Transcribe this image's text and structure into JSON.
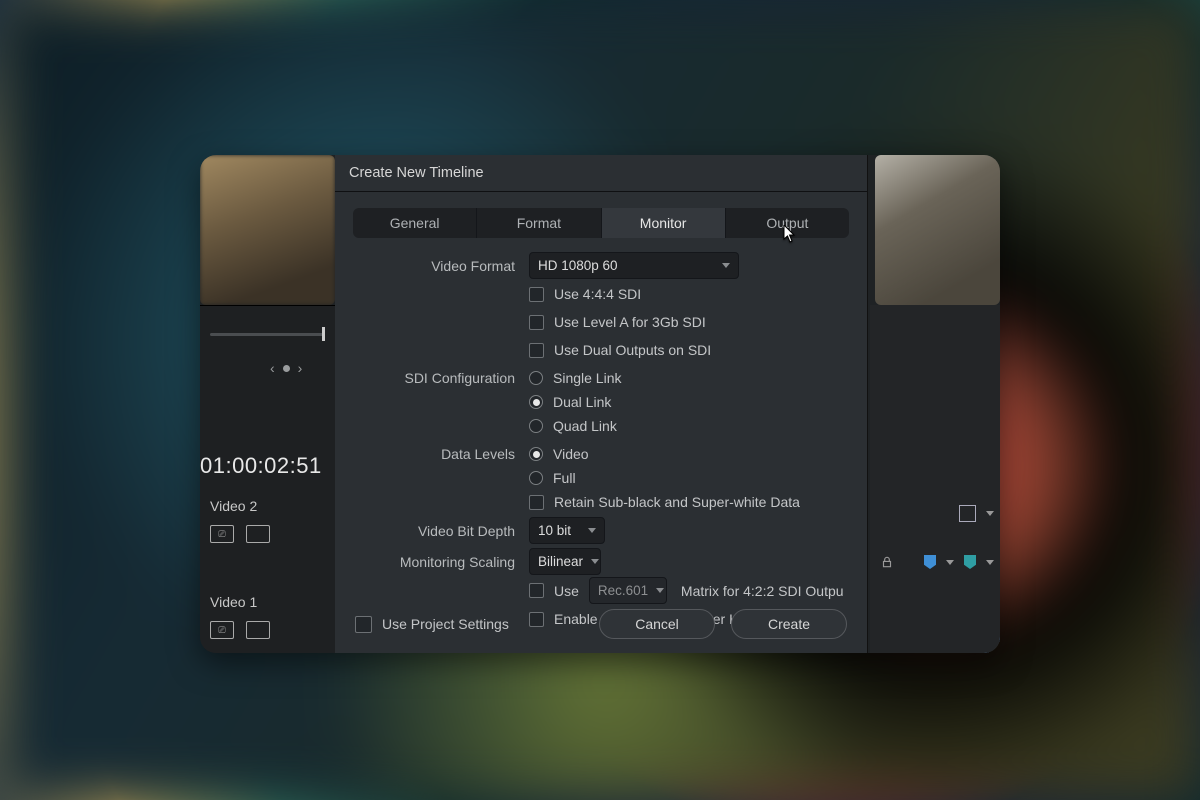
{
  "dialog": {
    "title": "Create New Timeline",
    "tabs": {
      "general": "General",
      "format": "Format",
      "monitor": "Monitor",
      "output": "Output"
    },
    "active_tab": "monitor",
    "labels": {
      "video_format": "Video Format",
      "sdi_config": "SDI Configuration",
      "data_levels": "Data Levels",
      "bit_depth": "Video Bit Depth",
      "scaling": "Monitoring Scaling"
    },
    "video_format_value": "HD 1080p 60",
    "use_444": "Use 4:4:4 SDI",
    "use_level_a": "Use Level A for 3Gb SDI",
    "use_dual_outputs": "Use Dual Outputs on SDI",
    "sdi": {
      "single": "Single Link",
      "dual": "Dual Link",
      "quad": "Quad Link"
    },
    "data": {
      "video": "Video",
      "full": "Full",
      "retain": "Retain Sub-black and Super-white Data"
    },
    "bit_depth_value": "10 bit",
    "scaling_value": "Bilinear",
    "matrix_use": "Use",
    "matrix_value": "Rec.601",
    "matrix_tail": "Matrix for 4:2:2 SDI Outpu",
    "hdr_hdmi": "Enable HDR Metadata over HDMI",
    "use_project_settings": "Use Project Settings",
    "cancel": "Cancel",
    "create": "Create"
  },
  "editor": {
    "timecode": "01:00:02:51",
    "track2": "Video 2",
    "track1": "Video 1",
    "pager_prev": "‹",
    "pager_next": "›"
  }
}
